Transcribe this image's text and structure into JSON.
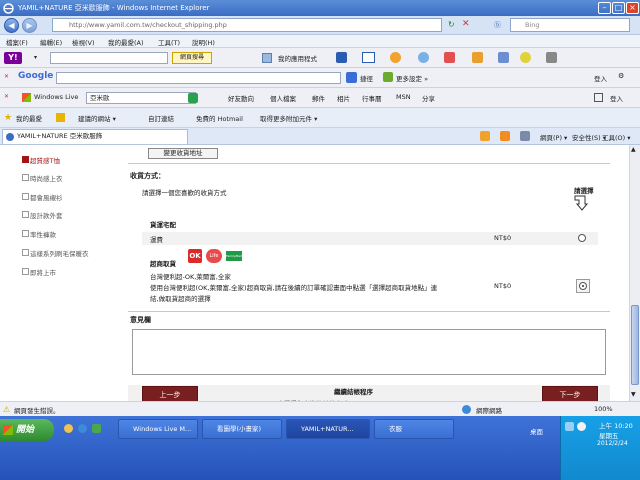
{
  "window": {
    "title": "YAMIL+NATURE 亞米歐服飾 - Windows Internet Explorer"
  },
  "address_bar": {
    "url": "http://www.yamil.com.tw/checkout_shipping.php",
    "search_placeholder": "Bing"
  },
  "menu": [
    "檔案(F)",
    "編輯(E)",
    "檢視(V)",
    "我的最愛(A)",
    "工具(T)",
    "說明(H)"
  ],
  "yahoo_toolbar": {
    "search_button": "網頁搜尋",
    "apps_label": "我的應用程式"
  },
  "google_toolbar": {
    "logo": "Google",
    "quick_label": "捷徑",
    "more_settings": "更多設定 »",
    "login": "登入"
  },
  "live_toolbar": {
    "logo": "Windows Live",
    "search_value": "亞米歐",
    "links": [
      "好友動向",
      "個人檔案",
      "郵件",
      "相片",
      "行事曆",
      "MSN",
      "分享"
    ],
    "login": "登入"
  },
  "favorites_bar": {
    "label": "我的最愛",
    "items": [
      "建議的網站 ▾",
      "自訂連結",
      "免費的 Hotmail",
      "取得更多附加元件 ▾"
    ]
  },
  "tab": {
    "title": "YAMIL+NATURE 亞米歐服飾"
  },
  "command_bar": {
    "page": "網頁(P) ▾",
    "safety": "安全性(S) ▾",
    "tools": "工具(O) ▾"
  },
  "sidebar": {
    "items": [
      "超質感T恤",
      "時尚感上衣",
      "都會風襯衫",
      "設計款外套",
      "率性褲款",
      "這樣系列刷毛保暖衣",
      "即將上市"
    ]
  },
  "checkout": {
    "change_address_button": "變更收貨地址",
    "shipping_method_title": "收貨方式：",
    "shipping_method_prompt": "請選擇一個您喜歡的收貨方式",
    "please_choose": "請選擇",
    "home_delivery_title": "貨運宅配",
    "home_delivery_option": "運費",
    "home_delivery_price": "NT$0",
    "store_pickup_title": "超商取貨",
    "store_pickup_line1": "台灣便利超-OK,萊爾富,全家",
    "store_pickup_line2": "使用台灣便利超(OK,萊爾富,全家)超商取貨,請在後續的訂單確認畫面中點選「選擇超商取貨地點」連",
    "store_pickup_line3": "結,做取貨超商的選擇",
    "store_pickup_price": "NT$0",
    "store_logos": [
      "OK",
      "Life",
      "FamilyMart"
    ],
    "comments_title": "意見欄",
    "comments_value": "",
    "prev_button": "上一步",
    "next_button": "下一步",
    "continue_title": "繼續結帳程序",
    "continue_subtitle": "下一步選擇您喜歡的付款方式"
  },
  "status_bar": {
    "left": "網頁發生錯誤。",
    "zone": "網際網路",
    "zoom": "100%"
  },
  "taskbar": {
    "start": "開始",
    "tasks": [
      "Windows Live M...",
      "看圖學(小畫家)",
      "YAMIL+NATUR...",
      "衣服"
    ],
    "desktop_label": "桌面",
    "time": "上午 10:20",
    "day": "星期五",
    "date": "2012/2/24"
  },
  "colors": {
    "accent_dark_red": "#7a1f1f",
    "sidebar_active": "#a01515",
    "title_blue": "#3b6cc4",
    "taskbar_blue": "#2552b8"
  }
}
